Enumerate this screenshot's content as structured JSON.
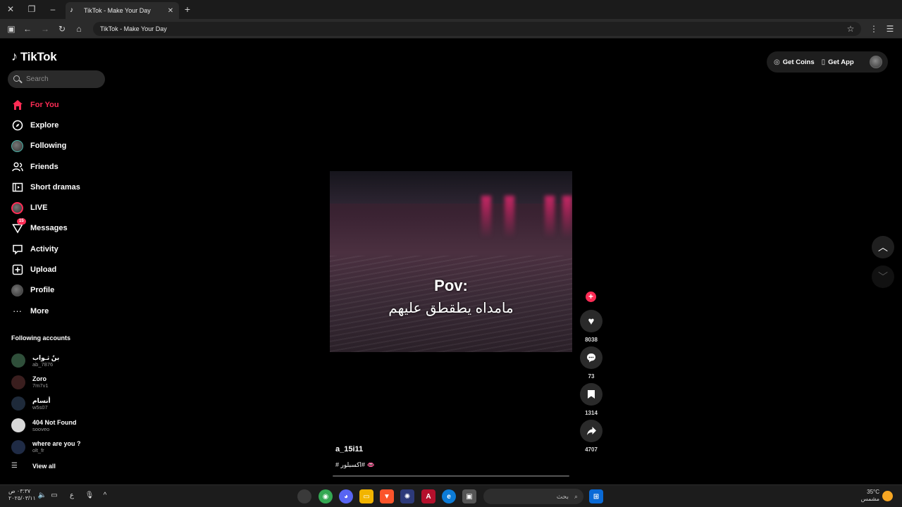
{
  "browser": {
    "tab_title": "TikTok - Make Your Day",
    "address": "TikTok - Make Your Day",
    "tab_favicon": "tiktok-note-icon"
  },
  "tiktok": {
    "logo_text": "TikTok",
    "search_placeholder": "Search",
    "nav": [
      {
        "label": "For You",
        "icon": "home-icon",
        "active": true
      },
      {
        "label": "Explore",
        "icon": "compass-icon"
      },
      {
        "label": "Following",
        "icon": "following-avatar-icon"
      },
      {
        "label": "Friends",
        "icon": "friends-icon"
      },
      {
        "label": "Short dramas",
        "icon": "film-icon"
      },
      {
        "label": "LIVE",
        "icon": "live-avatar-icon"
      },
      {
        "label": "Messages",
        "icon": "messages-icon",
        "badge": "15"
      },
      {
        "label": "Activity",
        "icon": "activity-icon"
      },
      {
        "label": "Upload",
        "icon": "upload-icon"
      },
      {
        "label": "Profile",
        "icon": "profile-avatar-icon"
      },
      {
        "label": "More",
        "icon": "more-icon"
      }
    ],
    "following_title": "Following accounts",
    "accounts": [
      {
        "name": "بنٌ ثـواب",
        "handle": "ab_7876",
        "color": "#2f4f3a"
      },
      {
        "name": "Zoro",
        "handle": "7m7v1",
        "color": "#3a1e1e"
      },
      {
        "name": "أنسام",
        "handle": "w5s07",
        "color": "#1e2a3a"
      },
      {
        "name": "404 Not Found",
        "handle": "sooveo",
        "color": "#d8d8d8"
      },
      {
        "name": "where are you ?",
        "handle": "olt_fr",
        "color": "#1f2b45"
      }
    ],
    "view_all": "View all",
    "header": {
      "get_coins": "Get Coins",
      "get_app": "Get App"
    },
    "video": {
      "caption_line1": "Pov:",
      "caption_line2": "مامداه يطقطق عليهم",
      "author": "a_15i11",
      "description": "# اكسبلور# 👄",
      "progress": 0.01
    },
    "actions": {
      "likes": "8038",
      "comments": "73",
      "saves": "1314",
      "shares": "4707"
    }
  },
  "taskbar": {
    "time": "٠٣:٣٧ ص",
    "date": "٢٠٢٥/٠٣/١١",
    "lang": "ع",
    "search_text": "بحث",
    "weather_temp": "35°C",
    "weather_desc": "مشمس"
  }
}
